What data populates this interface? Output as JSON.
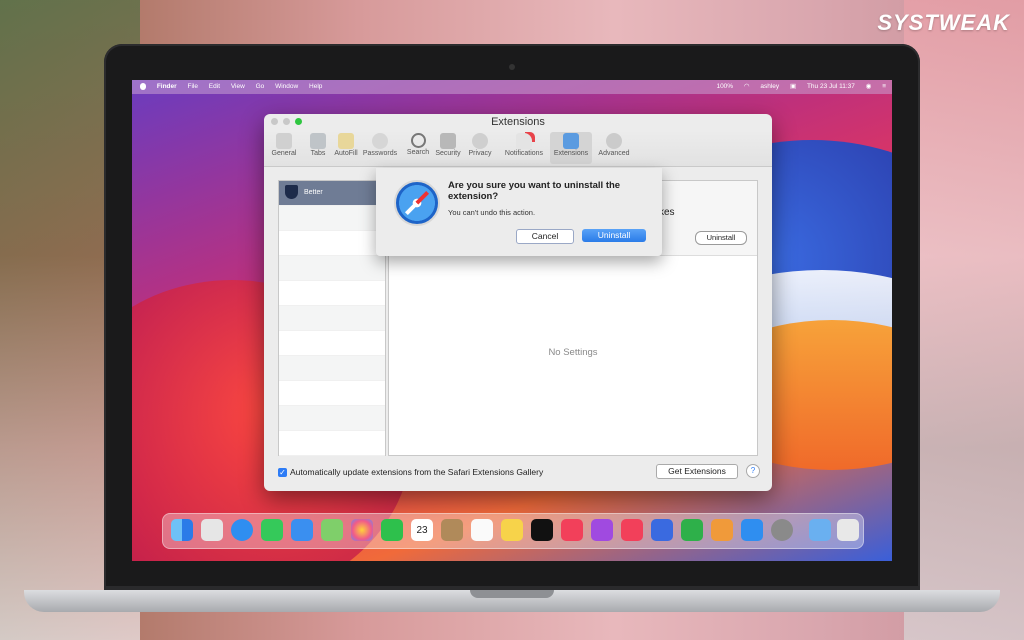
{
  "brand": "SYSTWEAK",
  "menubar": {
    "left": [
      "Finder",
      "File",
      "Edit",
      "View",
      "Go",
      "Window",
      "Help"
    ],
    "right": {
      "battery": "100%",
      "user": "ashley",
      "clock": "Thu 23 Jul  11:37"
    }
  },
  "window": {
    "title": "Extensions",
    "tabs": [
      "General",
      "Tabs",
      "AutoFill",
      "Passwords",
      "Search",
      "Security",
      "Privacy",
      "Notifications",
      "Extensions",
      "Advanced"
    ],
    "active_tab": "Extensions",
    "list": {
      "selected_item": "Better"
    },
    "detail": {
      "title_fragment": "kes",
      "uninstall_label": "Uninstall",
      "empty_text": "No Settings"
    },
    "footer": {
      "checkbox_label": "Automatically update extensions from the Safari Extensions Gallery",
      "checked": true,
      "get_extensions_label": "Get Extensions",
      "help_label": "?"
    }
  },
  "dialog": {
    "title": "Are you sure you want to uninstall the extension?",
    "message": "You can't undo this action.",
    "cancel_label": "Cancel",
    "confirm_label": "Uninstall"
  },
  "dock": {
    "calendar_day": "23",
    "apps": [
      "finder-icon",
      "launchpad-icon",
      "safari-icon",
      "messages-icon",
      "mail-icon",
      "maps-icon",
      "photos-icon",
      "facetime-icon",
      "calendar-icon",
      "contacts-icon",
      "reminders-icon",
      "notes-icon",
      "tv-icon",
      "music-icon",
      "podcasts-icon",
      "news-icon",
      "keynote-icon",
      "numbers-icon",
      "pages-icon",
      "app-store-icon",
      "system-preferences-icon",
      "downloads-folder-icon",
      "trash-icon"
    ]
  }
}
